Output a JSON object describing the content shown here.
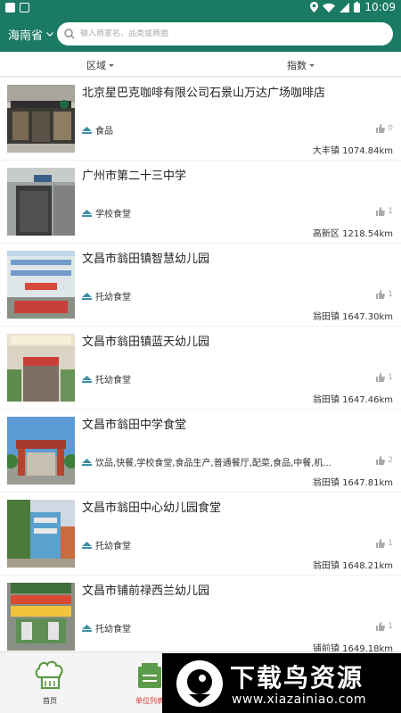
{
  "status_bar": {
    "time": "10:09"
  },
  "header": {
    "province": "海南省",
    "search_placeholder": "输入商家名、品类或商圈"
  },
  "filters": {
    "area": "区域",
    "index": "指数"
  },
  "list": [
    {
      "name": "北京星巴克咖啡有限公司石景山万达广场咖啡店",
      "category": "食品",
      "likes": "0",
      "town": "大丰镇",
      "distance": "1074.84km",
      "thumb": "starbucks"
    },
    {
      "name": "广州市第二十三中学",
      "category": "学校食堂",
      "likes": "1",
      "town": "高新区",
      "distance": "1218.54km",
      "thumb": "school"
    },
    {
      "name": "文昌市翁田镇智慧幼儿园",
      "category": "托幼食堂",
      "likes": "1",
      "town": "翁田镇",
      "distance": "1647.30km",
      "thumb": "kindergarten1"
    },
    {
      "name": "文昌市翁田镇蓝天幼儿园",
      "category": "托幼食堂",
      "likes": "1",
      "town": "翁田镇",
      "distance": "1647.46km",
      "thumb": "kindergarten2"
    },
    {
      "name": "文昌市翁田中学食堂",
      "category": "饮品,快餐,学校食堂,食品生产,普通餐厅,配菜,食品,中餐,机...",
      "likes": "2",
      "town": "翁田镇",
      "distance": "1647.81km",
      "thumb": "gate"
    },
    {
      "name": "文昌市翁田中心幼儿园食堂",
      "category": "托幼食堂",
      "likes": "1",
      "town": "翁田镇",
      "distance": "1648.21km",
      "thumb": "building"
    },
    {
      "name": "文昌市铺前禄西兰幼儿园",
      "category": "托幼食堂",
      "likes": "1",
      "town": "铺前镇",
      "distance": "1649.18km",
      "thumb": "kindergarten3"
    }
  ],
  "bottom_nav": {
    "home": "首页",
    "units": "单位列表"
  },
  "watermark": {
    "title": "下载鸟资源",
    "url": "www.xiazainiao.com"
  },
  "colors": {
    "primary": "#1b7a63",
    "text": "#222222",
    "accent_red": "#dd3333"
  }
}
